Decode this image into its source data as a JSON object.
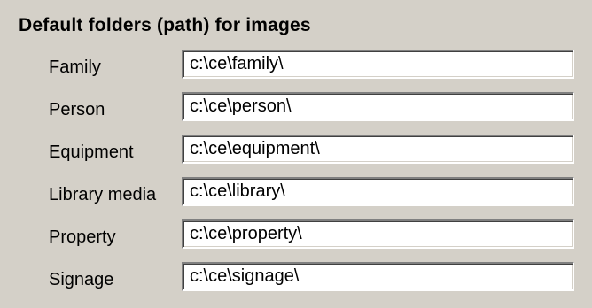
{
  "section": {
    "title": "Default folders (path) for images"
  },
  "folders": [
    {
      "label": "Family",
      "value": "c:\\ce\\family\\"
    },
    {
      "label": "Person",
      "value": "c:\\ce\\person\\"
    },
    {
      "label": "Equipment",
      "value": "c:\\ce\\equipment\\"
    },
    {
      "label": "Library media",
      "value": "c:\\ce\\library\\"
    },
    {
      "label": "Property",
      "value": "c:\\ce\\property\\"
    },
    {
      "label": "Signage",
      "value": "c:\\ce\\signage\\"
    }
  ],
  "colors": {
    "background": "#d4d0c8",
    "field_background": "#ffffff",
    "text": "#000000"
  }
}
